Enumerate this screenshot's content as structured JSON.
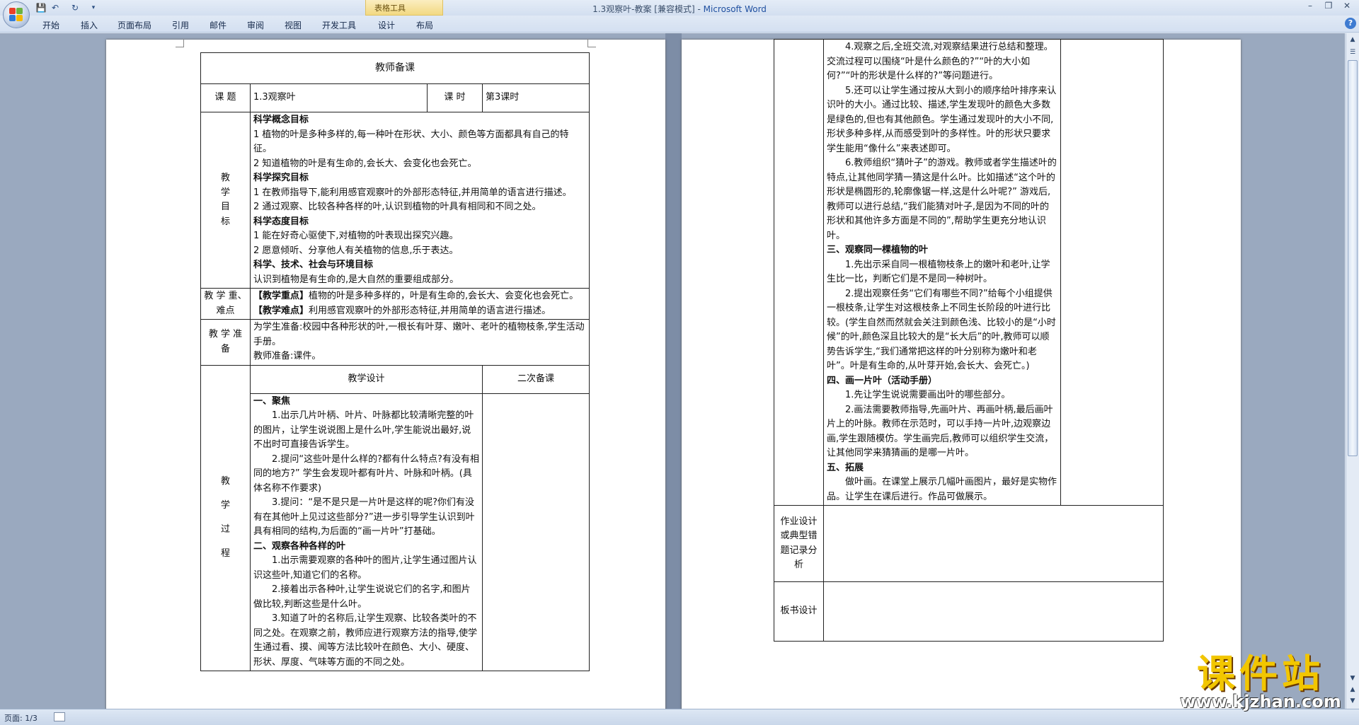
{
  "window": {
    "title": "1.3观察叶-教案 [兼容模式] - ",
    "app_name": "Microsoft Word",
    "contextual_tab_group": "表格工具"
  },
  "ribbon_tabs": [
    "开始",
    "插入",
    "页面布局",
    "引用",
    "邮件",
    "审阅",
    "视图",
    "开发工具",
    "设计",
    "布局"
  ],
  "status": {
    "page": "页面: 1/3"
  },
  "watermark": {
    "title": "课件站",
    "url": "www.kjzhan.com"
  },
  "colors": {
    "ribbon": "#d4e0f1",
    "workspace": "#9aa9bf",
    "brand": "#2050a0",
    "watermark_gold": "#f2c600"
  },
  "doc": {
    "header": "教师备课",
    "topic_label": "课  题",
    "topic": "1.3观察叶",
    "period_label": "课  时",
    "period": "第3课时",
    "goals_label": [
      "教",
      "学",
      "目",
      "标"
    ],
    "goals": [
      {
        "text": "科学概念目标",
        "bold": true
      },
      {
        "text": "1 植物的叶是多种多样的,每一种叶在形状、大小、颜色等方面都具有自己的特征。",
        "bold": false
      },
      {
        "text": "2 知道植物的叶是有生命的,会长大、会变化也会死亡。",
        "bold": false
      },
      {
        "text": "科学探究目标",
        "bold": true
      },
      {
        "text": "1  在教师指导下,能利用感官观察叶的外部形态特征,并用简单的语言进行描述。",
        "bold": false
      },
      {
        "text": "2 通过观察、比较各种各样的叶,认识到植物的叶具有相同和不同之处。",
        "bold": false
      },
      {
        "text": "科学态度目标",
        "bold": true
      },
      {
        "text": "1 能在好奇心驱使下,对植物的叶表现出探究兴趣。",
        "bold": false
      },
      {
        "text": "2 愿意倾听、分享他人有关植物的信息,乐于表达。",
        "bold": false
      },
      {
        "text": "科学、技术、社会与环境目标",
        "bold": true
      },
      {
        "text": "认识到植物是有生命的,是大自然的重要组成部分。",
        "bold": false
      }
    ],
    "key_label": "教 学 重、难点",
    "key_point_tag": "【教学重点】",
    "key_point": "植物的叶是多种多样的，叶是有生命的,会长大、会变化也会死亡。",
    "difficulty_tag": "【教学难点】",
    "difficulty": "利用感官观察叶的外部形态特征,并用简单的语言进行描述。",
    "prep_label": "教 学 准 备",
    "prep": [
      "为学生准备:校园中各种形状的叶,一根长有叶芽、嫩叶、老叶的植物枝条,学生活动手册。",
      "教师准备:课件。"
    ],
    "process_label": [
      "教",
      "学",
      "过",
      "程"
    ],
    "design_header": "教学设计",
    "second_header": "二次备课",
    "process_p1": [
      {
        "text": "一、聚焦",
        "bold": true,
        "cls": ""
      },
      {
        "text": "1.出示几片叶柄、叶片、叶脉都比较清晰完整的叶的图片，让学生说说图上是什么叶,学生能说出最好,说不出时可直接告诉学生。",
        "bold": false,
        "cls": "ind"
      },
      {
        "text": "2.提问“这些叶是什么样的?都有什么特点?有没有相同的地方?” 学生会发现叶都有叶片、叶脉和叶柄。(具体名称不作要求)",
        "bold": false,
        "cls": "ind"
      },
      {
        "text": "3.提问：“是不是只是一片叶是这样的呢?你们有没有在其他叶上见过这些部分?”进一步引导学生认识到叶具有相同的结构,为后面的“画一片叶”打基础。",
        "bold": false,
        "cls": "ind"
      },
      {
        "text": "二、观察各种各样的叶",
        "bold": true,
        "cls": ""
      },
      {
        "text": "1.出示需要观察的各种叶的图片,让学生通过图片认识这些叶,知道它们的名称。",
        "bold": false,
        "cls": "ind"
      },
      {
        "text": "2.接着出示各种叶,让学生说说它们的名字,和图片做比较,判断这些是什么叶。",
        "bold": false,
        "cls": "ind"
      },
      {
        "text": "3.知道了叶的名称后,让学生观察、比较各类叶的不同之处。在观察之前，教师应进行观察方法的指导,使学生通过看、摸、闻等方法比较叶在颜色、大小、硬度、形状、厚度、气味等方面的不同之处。",
        "bold": false,
        "cls": "ind"
      }
    ],
    "process_p2": [
      {
        "text": "4.观察之后,全班交流,对观察结果进行总结和整理。交流过程可以围绕“叶是什么颜色的?”“叶的大小如何?”“叶的形状是什么样的?”等问题进行。",
        "bold": false,
        "cls": "ind"
      },
      {
        "text": "5.还可以让学生通过按从大到小的顺序给叶排序来认识叶的大小。通过比较、描述,学生发现叶的颜色大多数是绿色的,但也有其他颜色。学生通过发现叶的大小不同,形状多种多样,从而感受到叶的多样性。叶的形状只要求学生能用“像什么”来表述即可。",
        "bold": false,
        "cls": "ind"
      },
      {
        "text": "6.教师组织“猜叶子”的游戏。教师或者学生描述叶的特点,让其他同学猜一猜这是什么叶。比如描述“这个叶的形状是椭圆形的,轮廓像锯一样,这是什么叶呢?” 游戏后,教师可以进行总结,“我们能猜对叶子,是因为不同的叶的形状和其他许多方面是不同的”,帮助学生更充分地认识叶。",
        "bold": false,
        "cls": "ind"
      },
      {
        "text": "三、观察同一棵植物的叶",
        "bold": true,
        "cls": ""
      },
      {
        "text": "1.先出示采自同一根植物枝条上的嫩叶和老叶,让学生比一比，判断它们是不是同一种树叶。",
        "bold": false,
        "cls": "ind"
      },
      {
        "text": "2.提出观察任务“它们有哪些不同?”给每个小组提供一根枝条,让学生对这根枝条上不同生长阶段的叶进行比较。(学生自然而然就会关注到颜色浅、比较小的是“小时候”的叶,颜色深且比较大的是“长大后”的叶,教师可以顺势告诉学生,“我们通常把这样的叶分别称为嫩叶和老叶”。叶是有生命的,从叶芽开始,会长大、会死亡。)",
        "bold": false,
        "cls": "ind"
      },
      {
        "text": "四、画一片叶（活动手册）",
        "bold": true,
        "cls": ""
      },
      {
        "text": "1.先让学生说说需要画出叶的哪些部分。",
        "bold": false,
        "cls": "ind"
      },
      {
        "text": "2.画法需要教师指导,先画叶片、再画叶柄,最后画叶片上的叶脉。教师在示范时，可以手持一片叶,边观察边画,学生跟随模仿。学生画完后,教师可以组织学生交流，让其他同学来猜猜画的是哪一片叶。",
        "bold": false,
        "cls": "ind"
      },
      {
        "text": "五、拓展",
        "bold": true,
        "cls": ""
      },
      {
        "text": "做叶画。在课堂上展示几幅叶画图片，最好是实物作品。让学生在课后进行。作品可做展示。",
        "bold": false,
        "cls": "ind"
      }
    ],
    "homework_label": "作业设计或典型错题记录分析",
    "board_label": "板书设计"
  }
}
